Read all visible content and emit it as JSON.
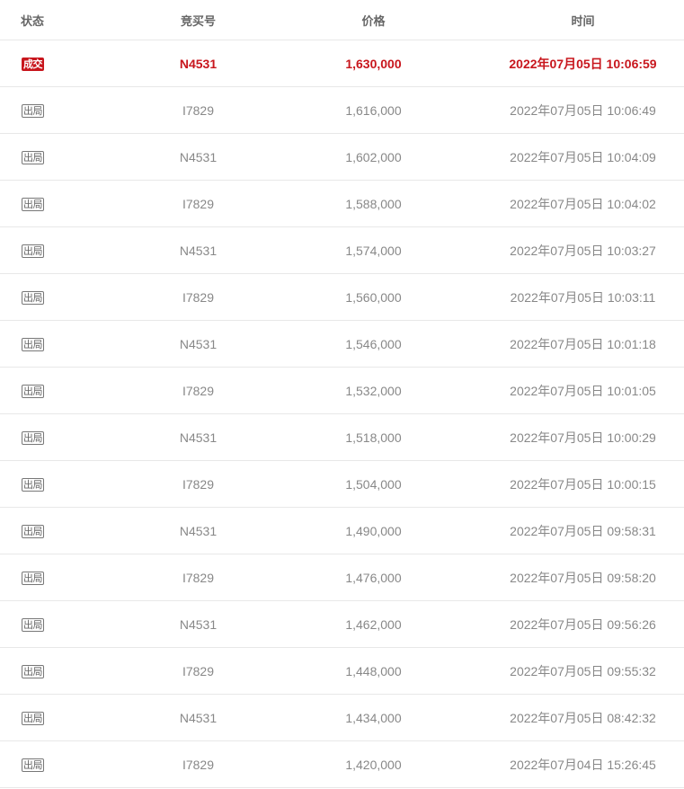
{
  "headers": {
    "status": "状态",
    "bidder": "竞买号",
    "price": "价格",
    "time": "时间"
  },
  "colors": {
    "deal_red": "#c8161d",
    "text_gray": "#888888",
    "border": "#e8e8e8"
  },
  "rows": [
    {
      "status": "成交",
      "bidder": "N4531",
      "price": "1,630,000",
      "time": "2022年07月05日 10:06:59",
      "highlight": true
    },
    {
      "status": "出局",
      "bidder": "I7829",
      "price": "1,616,000",
      "time": "2022年07月05日 10:06:49"
    },
    {
      "status": "出局",
      "bidder": "N4531",
      "price": "1,602,000",
      "time": "2022年07月05日 10:04:09"
    },
    {
      "status": "出局",
      "bidder": "I7829",
      "price": "1,588,000",
      "time": "2022年07月05日 10:04:02"
    },
    {
      "status": "出局",
      "bidder": "N4531",
      "price": "1,574,000",
      "time": "2022年07月05日 10:03:27"
    },
    {
      "status": "出局",
      "bidder": "I7829",
      "price": "1,560,000",
      "time": "2022年07月05日 10:03:11"
    },
    {
      "status": "出局",
      "bidder": "N4531",
      "price": "1,546,000",
      "time": "2022年07月05日 10:01:18"
    },
    {
      "status": "出局",
      "bidder": "I7829",
      "price": "1,532,000",
      "time": "2022年07月05日 10:01:05"
    },
    {
      "status": "出局",
      "bidder": "N4531",
      "price": "1,518,000",
      "time": "2022年07月05日 10:00:29"
    },
    {
      "status": "出局",
      "bidder": "I7829",
      "price": "1,504,000",
      "time": "2022年07月05日 10:00:15"
    },
    {
      "status": "出局",
      "bidder": "N4531",
      "price": "1,490,000",
      "time": "2022年07月05日 09:58:31"
    },
    {
      "status": "出局",
      "bidder": "I7829",
      "price": "1,476,000",
      "time": "2022年07月05日 09:58:20"
    },
    {
      "status": "出局",
      "bidder": "N4531",
      "price": "1,462,000",
      "time": "2022年07月05日 09:56:26"
    },
    {
      "status": "出局",
      "bidder": "I7829",
      "price": "1,448,000",
      "time": "2022年07月05日 09:55:32"
    },
    {
      "status": "出局",
      "bidder": "N4531",
      "price": "1,434,000",
      "time": "2022年07月05日 08:42:32"
    },
    {
      "status": "出局",
      "bidder": "I7829",
      "price": "1,420,000",
      "time": "2022年07月04日 15:26:45"
    }
  ]
}
